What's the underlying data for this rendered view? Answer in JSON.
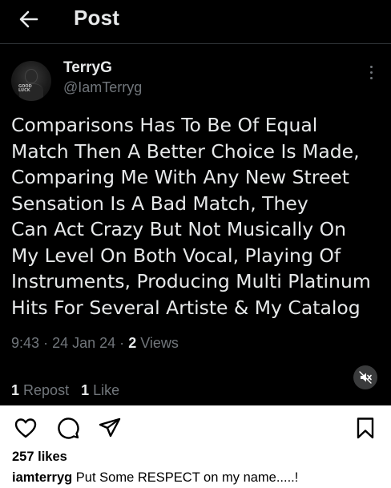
{
  "header": {
    "title": "Post"
  },
  "author": {
    "name": "TerryG",
    "handle": "@IamTerryg",
    "avatar_tag_line1": "GOOD",
    "avatar_tag_line2": "LUCK"
  },
  "post": {
    "lines": [
      "Comparisons Has To Be Of Equal",
      "Match Then A Better Choice Is Made,",
      "Comparing Me With Any New Street",
      "Sensation Is A Bad Match, They",
      "Can Act Crazy But Not Musically On",
      "My Level On Both Vocal, Playing Of",
      "Instruments, Producing Multi Platinum",
      "Hits For Several Artiste & My Catalog"
    ],
    "time": "9:43",
    "separator": "·",
    "date": "24 Jan 24",
    "views_count": "2",
    "views_label": "Views"
  },
  "stats": {
    "reposts_count": "1",
    "reposts_label": "Repost",
    "likes_count": "1",
    "likes_label": "Like"
  },
  "icons": {
    "back": "arrow-left-icon",
    "more": "vertical-ellipsis-icon",
    "mute": "speaker-muted-icon",
    "like": "heart-icon",
    "comment": "speech-bubble-icon",
    "share": "paper-plane-icon",
    "save": "bookmark-icon"
  },
  "instagram": {
    "likes_text": "257 likes",
    "caption_user": "iamterryg",
    "caption_text": "Put Some RESPECT on my name.....!"
  },
  "colors": {
    "post_background": "#000000",
    "primary_text": "#e7e9ea",
    "secondary_text": "#71767b",
    "page_background": "#ffffff"
  }
}
